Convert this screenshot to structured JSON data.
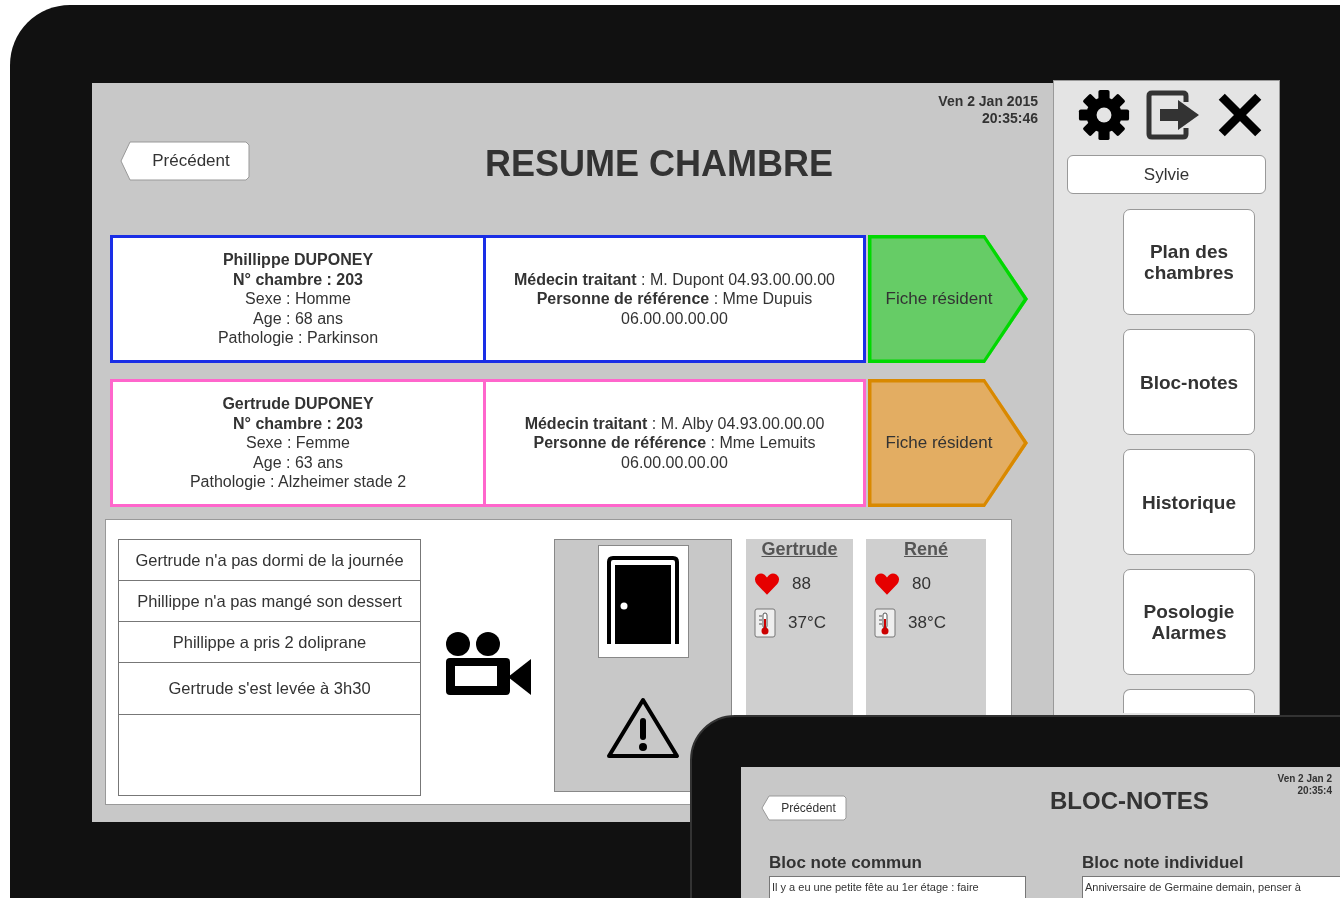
{
  "header": {
    "date": "Ven 2 Jan 2015",
    "time": "20:35:46",
    "back_button": "Précédent",
    "title": "RESUME CHAMBRE"
  },
  "residents": [
    {
      "name": "Phillippe DUPONEY",
      "room": "N° chambre : 203",
      "details": [
        "Sexe : Homme",
        "Age : 68 ans",
        "Pathologie : Parkinson"
      ],
      "contacts": [
        "**Médecin traitant** : M. Dupont 04.93.00.00.00",
        "**Personne de référence** : Mme Dupuis",
        "06.00.00.00.00"
      ],
      "color": "#1a2ee6",
      "button": {
        "label": "Fiche résident",
        "color": "#66cc66"
      }
    },
    {
      "name": "Gertrude DUPONEY",
      "room": "N° chambre : 203",
      "details": [
        "Sexe : Femme",
        "Age : 63 ans",
        "Pathologie : Alzheimer stade 2"
      ],
      "contacts": [
        "**Médecin traitant** : M. Alby 04.93.00.00.00",
        "**Personne de référence** : Mme Lemuits",
        "06.00.00.00.00"
      ],
      "color": "#ff66cc",
      "button": {
        "label": "Fiche résident",
        "color": "#e3ad62"
      }
    }
  ],
  "notes": [
    "Gertrude n'a pas dormi de la journée",
    "Phillippe n'a pas mangé son dessert",
    "Phillippe a pris 2 doliprane",
    "Gertrude s'est levée à 3h30"
  ],
  "vitals": [
    {
      "name": "Gertrude",
      "heart_rate": "88",
      "temperature": "37°C"
    },
    {
      "name": "René",
      "heart_rate": "80",
      "temperature": "38°C"
    }
  ],
  "sidebar": {
    "user": "Sylvie",
    "items": [
      "Plan des chambres",
      "Bloc-notes",
      "Historique",
      "Posologie Alarmes"
    ]
  },
  "notes_preview": {
    "date": "Ven 2 Jan 2",
    "time": "20:35:4",
    "back_button": "Précédent",
    "title": "BLOC-NOTES",
    "common_title": "Bloc note commun",
    "common_text": "Il y a eu une petite fête au 1er étage : faire",
    "individual_title": "Bloc note individuel",
    "individual_text": "Anniversaire de Germaine demain, penser à"
  }
}
